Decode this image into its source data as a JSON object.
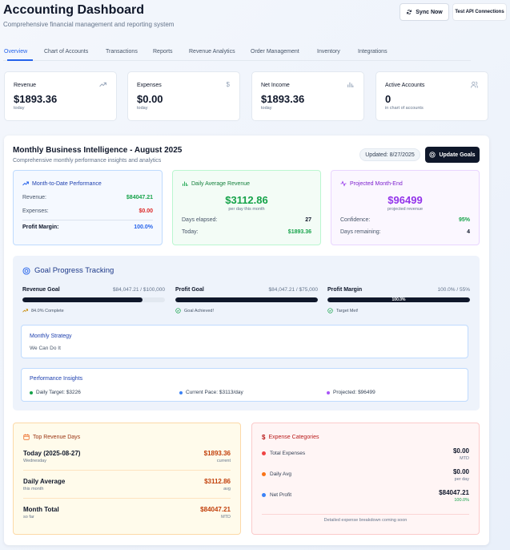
{
  "header": {
    "title": "Accounting Dashboard",
    "subtitle": "Comprehensive financial management and reporting system",
    "sync_label": "Sync Now",
    "test_api_label": "Test API Connections"
  },
  "tabs": [
    {
      "label": "Overview",
      "active": true
    },
    {
      "label": "Chart of Accounts"
    },
    {
      "label": "Transactions"
    },
    {
      "label": "Reports"
    },
    {
      "label": "Revenue Analytics"
    },
    {
      "label": "Order Management"
    },
    {
      "label": "Inventory"
    },
    {
      "label": "Integrations"
    }
  ],
  "kpis": [
    {
      "label": "Revenue",
      "value": "$1893.36",
      "sub": "today",
      "icon": "trending-up-icon"
    },
    {
      "label": "Expenses",
      "value": "$0.00",
      "sub": "today",
      "icon": "dollar-icon"
    },
    {
      "label": "Net Income",
      "value": "$1893.36",
      "sub": "today",
      "icon": "bar-chart-icon"
    },
    {
      "label": "Active Accounts",
      "value": "0",
      "sub": "in chart of accounts",
      "icon": "users-icon"
    }
  ],
  "bi": {
    "title": "Monthly Business Intelligence - August 2025",
    "subtitle": "Comprehensive monthly performance insights and analytics",
    "updated": "Updated: 8/27/2025",
    "update_goals": "Update Goals",
    "mtd": {
      "title": "Month-to-Date Performance",
      "revenue_label": "Revenue:",
      "revenue": "$84047.21",
      "expenses_label": "Expenses:",
      "expenses": "$0.00",
      "margin_label": "Profit Margin:",
      "margin": "100.0%"
    },
    "daily": {
      "title": "Daily Average Revenue",
      "value": "$3112.86",
      "caption": "per day this month",
      "elapsed_label": "Days elapsed:",
      "elapsed": "27",
      "today_label": "Today:",
      "today": "$1893.36"
    },
    "projected": {
      "title": "Projected Month-End",
      "value": "$96499",
      "caption": "projected revenue",
      "confidence_label": "Confidence:",
      "confidence": "95%",
      "remaining_label": "Days remaining:",
      "remaining": "4"
    },
    "goals": {
      "title": "Goal Progress Tracking",
      "items": [
        {
          "label": "Revenue Goal",
          "ratio": "$84,047.21 / $100,000",
          "progress": 0.84,
          "bar_text": "",
          "status": "84.0% Complete"
        },
        {
          "label": "Profit Goal",
          "ratio": "$84,047.21 / $75,000",
          "progress": 1.0,
          "bar_text": "",
          "status": "Goal Achieved!"
        },
        {
          "label": "Profit Margin",
          "ratio": "100.0% / 55%",
          "progress": 1.0,
          "bar_text": "100.0%",
          "status": "Target Met!"
        }
      ],
      "strategy_title": "Monthly Strategy",
      "strategy_text": "We Can Do It",
      "insights_title": "Performance Insights",
      "insights": [
        "Daily Target: $3226",
        "Current Pace: $3113/day",
        "Projected: $96499"
      ]
    },
    "top_days": {
      "title": "Top Revenue Days",
      "rows": [
        {
          "label": "Today (2025-08-27)",
          "sub": "Wednesday",
          "value": "$1893.36",
          "unit": "current"
        },
        {
          "label": "Daily Average",
          "sub": "this month",
          "value": "$3112.86",
          "unit": "avg"
        },
        {
          "label": "Month Total",
          "sub": "so far",
          "value": "$84047.21",
          "unit": "MTD"
        }
      ]
    },
    "expenses": {
      "title": "Expense Categories",
      "rows": [
        {
          "label": "Total Expenses",
          "value": "$0.00",
          "unit": "MTD",
          "color": "#ef4444"
        },
        {
          "label": "Daily Avg",
          "value": "$0.00",
          "unit": "per day",
          "color": "#f97316"
        },
        {
          "label": "Net Profit",
          "value": "$84047.21",
          "unit": "100.0%",
          "color": "#3b82f6"
        }
      ],
      "note": "Detailed expense breakdown coming soon"
    }
  },
  "colors": {
    "accent": "#2563eb",
    "green": "#16a34a",
    "red": "#dc2626",
    "purple": "#9333ea",
    "orange": "#c2410c"
  }
}
